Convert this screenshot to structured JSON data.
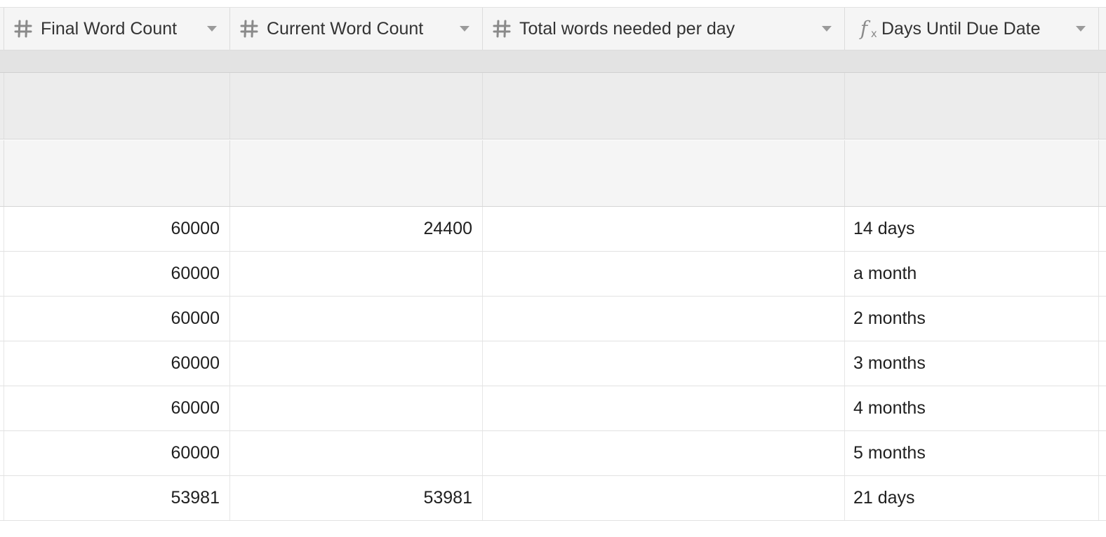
{
  "columns": [
    {
      "label": "Final Word Count",
      "icon": "number-icon"
    },
    {
      "label": "Current Word Count",
      "icon": "number-icon"
    },
    {
      "label": "Total words needed per day",
      "icon": "number-icon"
    },
    {
      "label": "Days Until Due Date",
      "icon": "formula-icon"
    }
  ],
  "rows": [
    {
      "final": "60000",
      "current": "24400",
      "per_day": "",
      "days": "14 days"
    },
    {
      "final": "60000",
      "current": "",
      "per_day": "",
      "days": "a month"
    },
    {
      "final": "60000",
      "current": "",
      "per_day": "",
      "days": "2 months"
    },
    {
      "final": "60000",
      "current": "",
      "per_day": "",
      "days": "3 months"
    },
    {
      "final": "60000",
      "current": "",
      "per_day": "",
      "days": "4 months"
    },
    {
      "final": "60000",
      "current": "",
      "per_day": "",
      "days": "5 months"
    },
    {
      "final": "53981",
      "current": "53981",
      "per_day": "",
      "days": "21 days"
    }
  ]
}
